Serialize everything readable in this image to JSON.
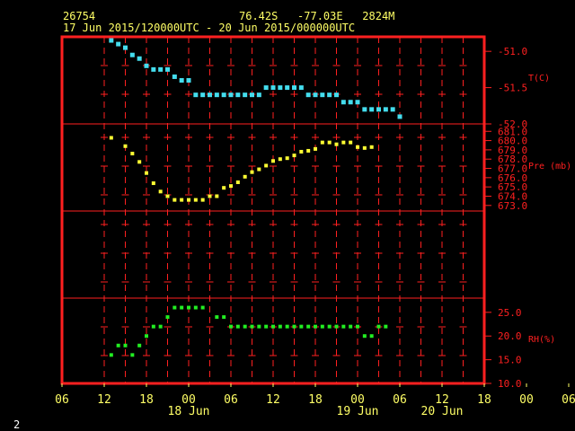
{
  "header": {
    "station_id": "26754",
    "position": "76.42S   -77.03E   2824M",
    "period": "17 Jun 2015/120000UTC - 20 Jun 2015/000000UTC",
    "page_number": "2"
  },
  "colors": {
    "frame": "#ff2020",
    "tick_labels": "#ffff66",
    "temperature": "#44ddee",
    "pressure": "#ffff33",
    "humidity": "#22ee22"
  },
  "chart_data": [
    {
      "type": "scatter",
      "series": [
        {
          "x": [
            13,
            14,
            15,
            16,
            17,
            18,
            19,
            20,
            21,
            22,
            23,
            24,
            25,
            26,
            27,
            28,
            29,
            30,
            31,
            32,
            33,
            34,
            35,
            36,
            37,
            38,
            39,
            40,
            41,
            42,
            43,
            44,
            45,
            46,
            47,
            48,
            49,
            50,
            51,
            52,
            53,
            54,
            55,
            56,
            57,
            58,
            59,
            60
          ],
          "y": [
            -50.85,
            -50.9,
            -50.95,
            -51.05,
            -51.1,
            -51.2,
            -51.25,
            -51.25,
            -51.25,
            -51.35,
            -51.4,
            -51.4,
            -51.6,
            -51.6,
            -51.6,
            -51.6,
            -51.6,
            -51.6,
            -51.6,
            -51.6,
            -51.6,
            -51.6,
            -51.5,
            -51.5,
            -51.5,
            -51.5,
            -51.5,
            -51.5,
            -51.6,
            -51.6,
            -51.6,
            -51.6,
            -51.6,
            -51.7,
            -51.7,
            -51.7,
            -51.8,
            -51.8,
            -51.8,
            -51.8,
            -51.8,
            -51.9,
            null,
            null,
            null,
            null,
            null,
            null
          ]
        }
      ],
      "ylabel": "T(C)",
      "ylim": [
        -52.0,
        -50.8
      ],
      "yticks": [
        "-51.0",
        "-51.5",
        "-52.0"
      ],
      "grid": true
    },
    {
      "type": "scatter",
      "series": [
        {
          "x": [
            13,
            15,
            16,
            17,
            18,
            19,
            20,
            21,
            22,
            23,
            24,
            25,
            26,
            27,
            28,
            29,
            30,
            31,
            32,
            33,
            34,
            35,
            36,
            37,
            38,
            39,
            40,
            41,
            42,
            43,
            44,
            45,
            46,
            47,
            48,
            49,
            50,
            51,
            52,
            53,
            54,
            55,
            56,
            57,
            58,
            59,
            60,
            61,
            62
          ],
          "y": [
            680.3,
            679.4,
            678.6,
            677.7,
            676.5,
            675.4,
            674.5,
            674.0,
            673.6,
            673.6,
            673.6,
            673.6,
            673.6,
            674.0,
            674.0,
            674.9,
            675.1,
            675.5,
            676.1,
            676.6,
            676.9,
            677.3,
            677.8,
            678.0,
            678.1,
            678.4,
            678.8,
            678.9,
            679.1,
            679.8,
            679.8,
            679.6,
            679.8,
            679.8,
            679.3,
            679.2,
            679.3,
            null,
            null,
            null,
            null,
            null,
            null,
            null,
            null,
            null,
            null,
            null,
            null
          ]
        }
      ],
      "ylabel": "Pre (mb)",
      "ylim": [
        672.4,
        681.8
      ],
      "yticks": [
        "673.0",
        "674.0",
        "675.0",
        "676.0",
        "677.0",
        "678.0",
        "679.0",
        "680.0",
        "681.0"
      ],
      "grid": true
    },
    {
      "type": "scatter",
      "series": [
        {
          "x": [
            13,
            14,
            15,
            16,
            17,
            18,
            19,
            20,
            21,
            22,
            23,
            24,
            25,
            26,
            27,
            28,
            29,
            30,
            31,
            32,
            33,
            34,
            35,
            36,
            37,
            38,
            39,
            40,
            41,
            42,
            43,
            44,
            45,
            46,
            47,
            48,
            49,
            50,
            51,
            52,
            53,
            54,
            55,
            56,
            57,
            58,
            59,
            60
          ],
          "y": [
            16,
            18,
            18,
            16,
            18,
            20,
            22,
            22,
            24,
            26,
            26,
            26,
            26,
            26,
            null,
            24,
            24,
            22,
            22,
            22,
            22,
            22,
            22,
            22,
            22,
            22,
            22,
            22,
            22,
            22,
            22,
            22,
            22,
            22,
            22,
            22,
            20,
            20,
            22,
            22,
            null,
            null,
            null,
            null,
            null,
            null,
            null,
            null
          ]
        }
      ],
      "ylabel": "RH(%)",
      "ylim": [
        10.0,
        28.0
      ],
      "yticks": [
        "10.0",
        "15.0",
        "20.0",
        "25.0"
      ],
      "grid": true
    }
  ],
  "x_axis": {
    "tick_labels": [
      "06",
      "12",
      "18",
      "00",
      "06",
      "12",
      "18",
      "00",
      "06",
      "12",
      "18",
      "00",
      "06"
    ],
    "date_labels": [
      "18 Jun",
      "19 Jun",
      "20 Jun"
    ]
  }
}
